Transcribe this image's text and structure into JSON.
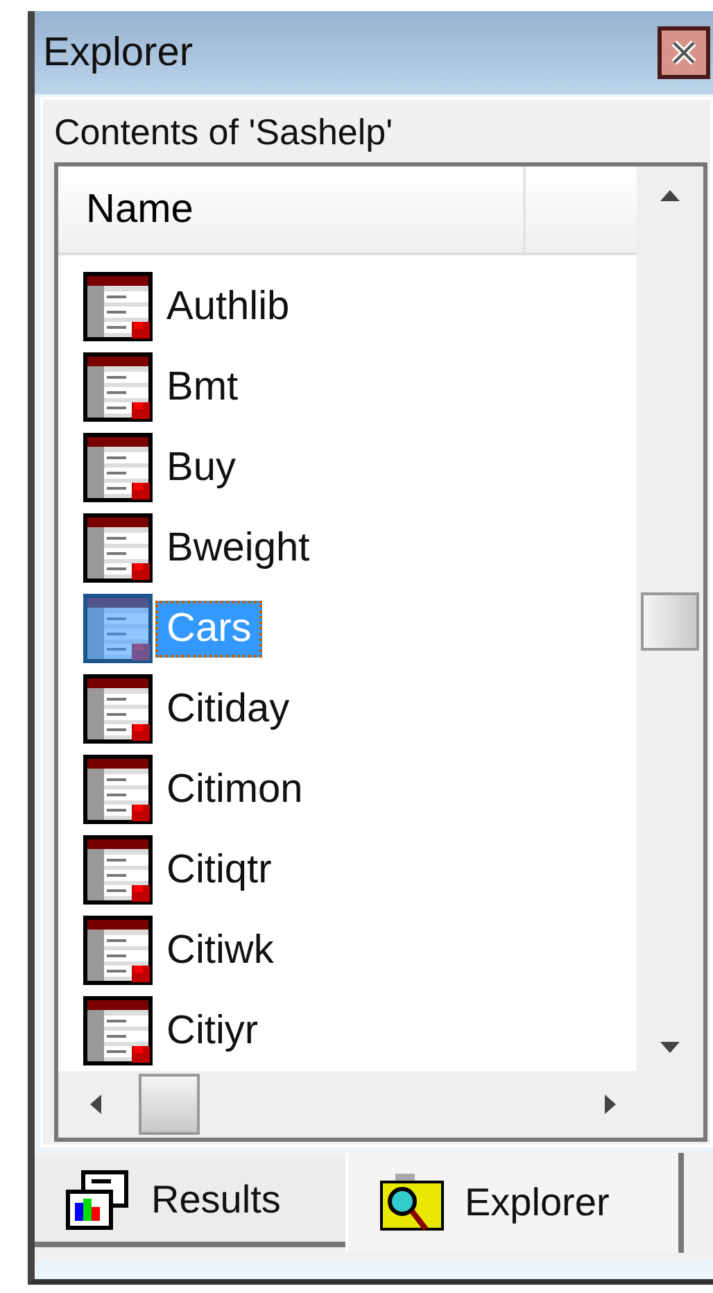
{
  "window": {
    "title": "Explorer"
  },
  "caption": "Contents of 'Sashelp'",
  "list": {
    "columns": [
      "Name"
    ],
    "items": [
      {
        "name": "Authlib",
        "selected": false
      },
      {
        "name": "Bmt",
        "selected": false
      },
      {
        "name": "Buy",
        "selected": false
      },
      {
        "name": "Bweight",
        "selected": false
      },
      {
        "name": "Cars",
        "selected": true
      },
      {
        "name": "Citiday",
        "selected": false
      },
      {
        "name": "Citimon",
        "selected": false
      },
      {
        "name": "Citiqtr",
        "selected": false
      },
      {
        "name": "Citiwk",
        "selected": false
      },
      {
        "name": "Citiyr",
        "selected": false
      }
    ]
  },
  "tabs": [
    {
      "label": "Results",
      "kind": "results",
      "selected": false
    },
    {
      "label": "Explorer",
      "kind": "explorer",
      "selected": true
    }
  ]
}
